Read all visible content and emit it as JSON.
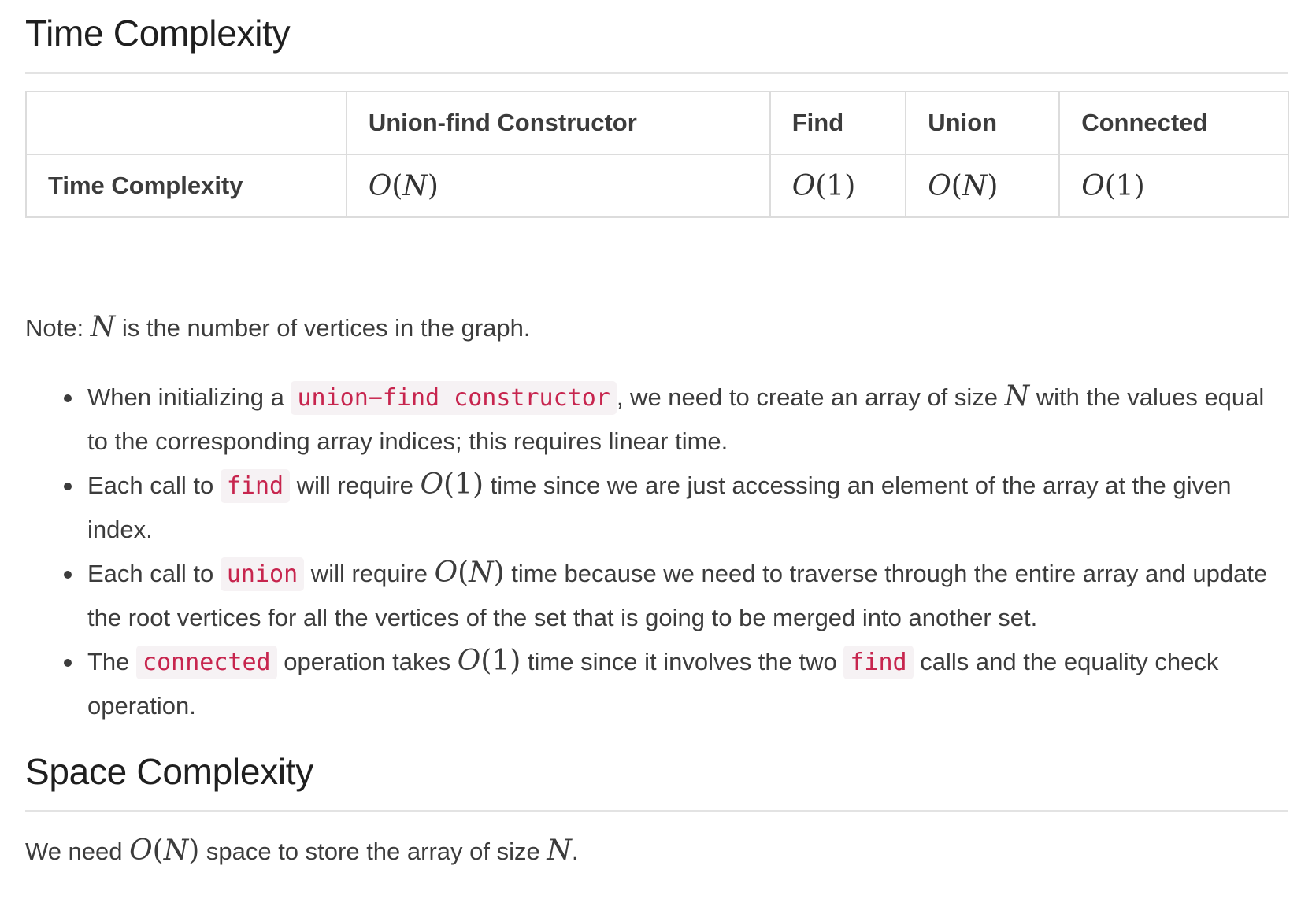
{
  "time_section": {
    "title": "Time Complexity",
    "table": {
      "headers": [
        "",
        "Union-find Constructor",
        "Find",
        "Union",
        "Connected"
      ],
      "row_label": "Time Complexity",
      "values": [
        {
          "fn": "O",
          "arg": "N"
        },
        {
          "fn": "O",
          "arg": "1"
        },
        {
          "fn": "O",
          "arg": "N"
        },
        {
          "fn": "O",
          "arg": "1"
        }
      ]
    },
    "note": {
      "prefix": "Note: ",
      "var": "N",
      "suffix": " is the number of vertices in the graph."
    },
    "bullets": [
      {
        "t1": "When initializing a ",
        "code1": "union−find constructor",
        "t2": ", we need to create an array of size ",
        "var": "N",
        "t3": " with the values equal to the corresponding array indices; this requires linear time."
      },
      {
        "t1": "Each call to ",
        "code1": "find",
        "t2": " will require ",
        "math_fn": "O",
        "math_arg": "1",
        "t3": " time since we are just accessing an element of the array at the given index."
      },
      {
        "t1": "Each call to ",
        "code1": "union",
        "t2": " will require ",
        "math_fn": "O",
        "math_arg": "N",
        "t3": " time because we need to traverse through the entire array and update the root vertices for all the vertices of the set that is going to be merged into another set."
      },
      {
        "t1": "The ",
        "code1": "connected",
        "t2": " operation takes ",
        "math_fn": "O",
        "math_arg": "1",
        "t3": " time since it involves the two ",
        "code2": "find",
        "t4": " calls and the equality check operation."
      }
    ]
  },
  "space_section": {
    "title": "Space Complexity",
    "t1": "We need ",
    "math_fn": "O",
    "math_arg": "N",
    "t2": " space to store the array of size ",
    "var": "N",
    "t3": "."
  },
  "colors": {
    "text": "#3c3c3c",
    "heading": "#1f1f1f",
    "code_text": "#c7254e",
    "code_bg": "#f6f2f4",
    "border": "#dcdcdc"
  }
}
